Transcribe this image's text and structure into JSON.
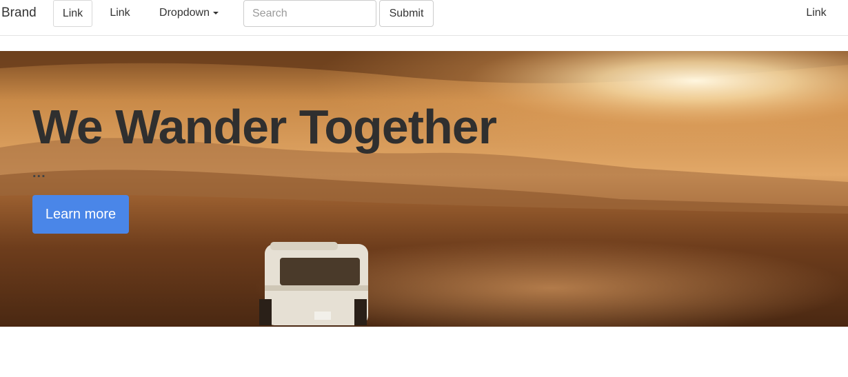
{
  "navbar": {
    "brand": "Brand",
    "link_1": "Link",
    "link_2": "Link",
    "dropdown": "Dropdown",
    "search_placeholder": "Search",
    "submit_label": "Submit",
    "link_right": "Link"
  },
  "hero": {
    "title": "We Wander Together",
    "subtitle": "...",
    "cta_label": "Learn more",
    "background_image": "desert sunset with van driving on dusty plain"
  },
  "colors": {
    "cta_background": "#4a86e8",
    "title_text": "#2f2f2f",
    "navbar_border": "#e3e3e3"
  }
}
